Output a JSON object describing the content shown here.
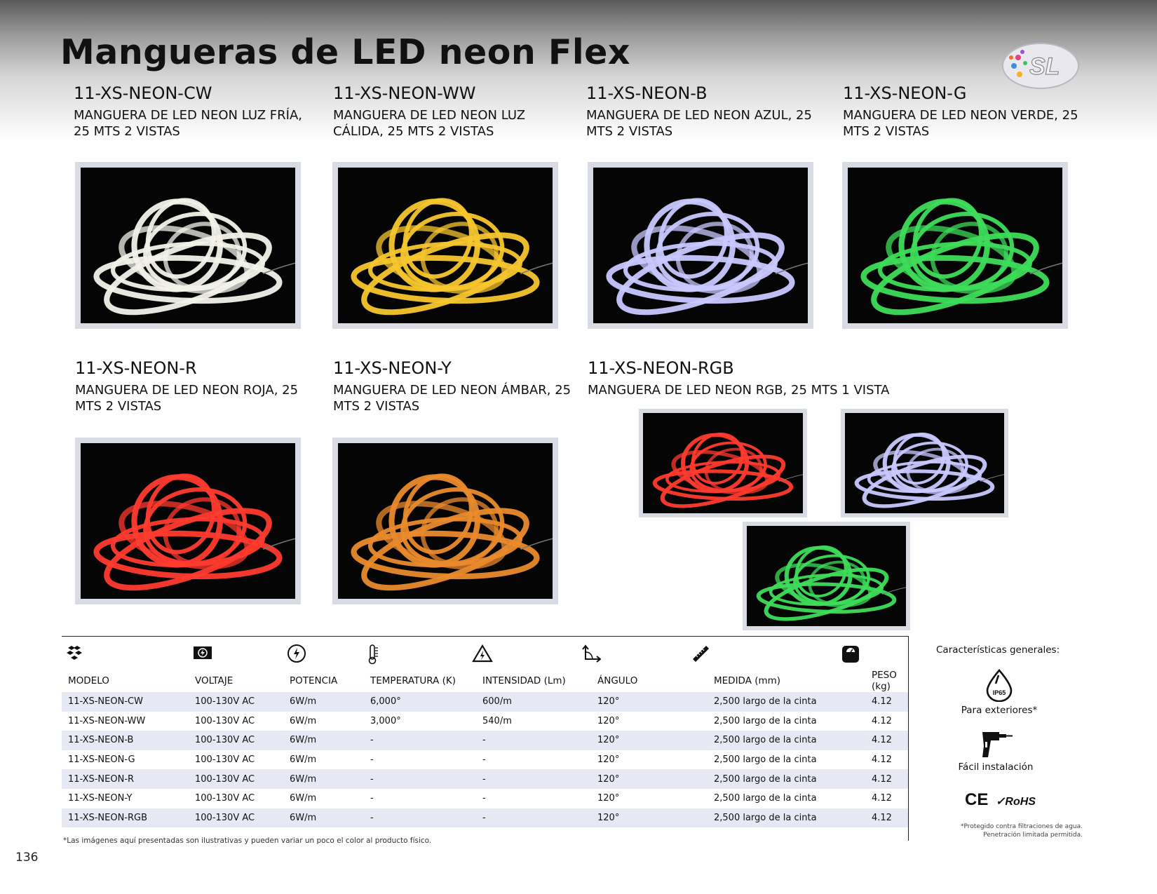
{
  "title": "Mangueras de LED neon Flex",
  "logo_text": "SL",
  "products": [
    {
      "code": "11-XS-NEON-CW",
      "desc": "MANGUERA DE LED NEON LUZ FRÍA, 25 MTS 2 VISTAS",
      "color": "#f2f2ea"
    },
    {
      "code": "11-XS-NEON-WW",
      "desc": "MANGUERA DE LED NEON LUZ CÁLIDA, 25 MTS 2 VISTAS",
      "color": "#f7c62e"
    },
    {
      "code": "11-XS-NEON-B",
      "desc": "MANGUERA DE LED NEON AZUL, 25 MTS 2 VISTAS",
      "color": "#c9c8ff"
    },
    {
      "code": "11-XS-NEON-G",
      "desc": "MANGUERA DE LED NEON VERDE, 25 MTS 2 VISTAS",
      "color": "#3ddc5a"
    },
    {
      "code": "11-XS-NEON-R",
      "desc": "MANGUERA DE LED NEON ROJA, 25 MTS 2 VISTAS",
      "color": "#ff3a2e"
    },
    {
      "code": "11-XS-NEON-Y",
      "desc": "MANGUERA DE LED NEON ÁMBAR, 25 MTS 2 VISTAS",
      "color": "#e98a2c"
    },
    {
      "code": "11-XS-NEON-RGB",
      "desc": "MANGUERA DE LED NEON RGB, 25 MTS 1 VISTA",
      "color": "#ff3a2e"
    }
  ],
  "rgb_views": [
    "#ff3a2e",
    "#c9c8ff",
    "#3ddc5a"
  ],
  "table": {
    "headers": [
      "MODELO",
      "VOLTAJE",
      "POTENCIA",
      "TEMPERATURA (K)",
      "INTENSIDAD (Lm)",
      "ÁNGULO",
      "MEDIDA (mm)",
      "PESO (kg)"
    ],
    "header_icons": [
      "boxes-icon",
      "voltage-icon",
      "power-icon",
      "thermometer-icon",
      "warning-icon",
      "angle-icon",
      "ruler-icon",
      "scale-icon"
    ],
    "rows": [
      [
        "11-XS-NEON-CW",
        "100-130V AC",
        "6W/m",
        "6,000°",
        "600/m",
        "120°",
        "2,500 largo de la cinta",
        "4.12"
      ],
      [
        "11-XS-NEON-WW",
        "100-130V AC",
        "6W/m",
        "3,000°",
        "540/m",
        "120°",
        "2,500 largo de la cinta",
        "4.12"
      ],
      [
        "11-XS-NEON-B",
        "100-130V AC",
        "6W/m",
        "-",
        "-",
        "120°",
        "2,500 largo de la cinta",
        "4.12"
      ],
      [
        "11-XS-NEON-G",
        "100-130V AC",
        "6W/m",
        "-",
        "-",
        "120°",
        "2,500 largo de la cinta",
        "4.12"
      ],
      [
        "11-XS-NEON-R",
        "100-130V AC",
        "6W/m",
        "-",
        "-",
        "120°",
        "2,500 largo de la cinta",
        "4.12"
      ],
      [
        "11-XS-NEON-Y",
        "100-130V AC",
        "6W/m",
        "-",
        "-",
        "120°",
        "2,500 largo de la cinta",
        "4.12"
      ],
      [
        "11-XS-NEON-RGB",
        "100-130V AC",
        "6W/m",
        "-",
        "-",
        "120°",
        "2,500 largo de la cinta",
        "4.12"
      ]
    ]
  },
  "features": {
    "title": "Características generales:",
    "ip_badge": "IP65",
    "outdoor": "Para exteriores*",
    "install": "Fácil instalación",
    "cert_ce": "CE",
    "cert_rohs": "RoHS"
  },
  "footnote": "*Las imágenes aquí presentadas son ilustrativas y pueden variar un poco el color al producto físico.",
  "note_line1": "*Protegido contra filtraciones de agua.",
  "note_line2": "Penetración limitada permitida.",
  "page_number": "136"
}
